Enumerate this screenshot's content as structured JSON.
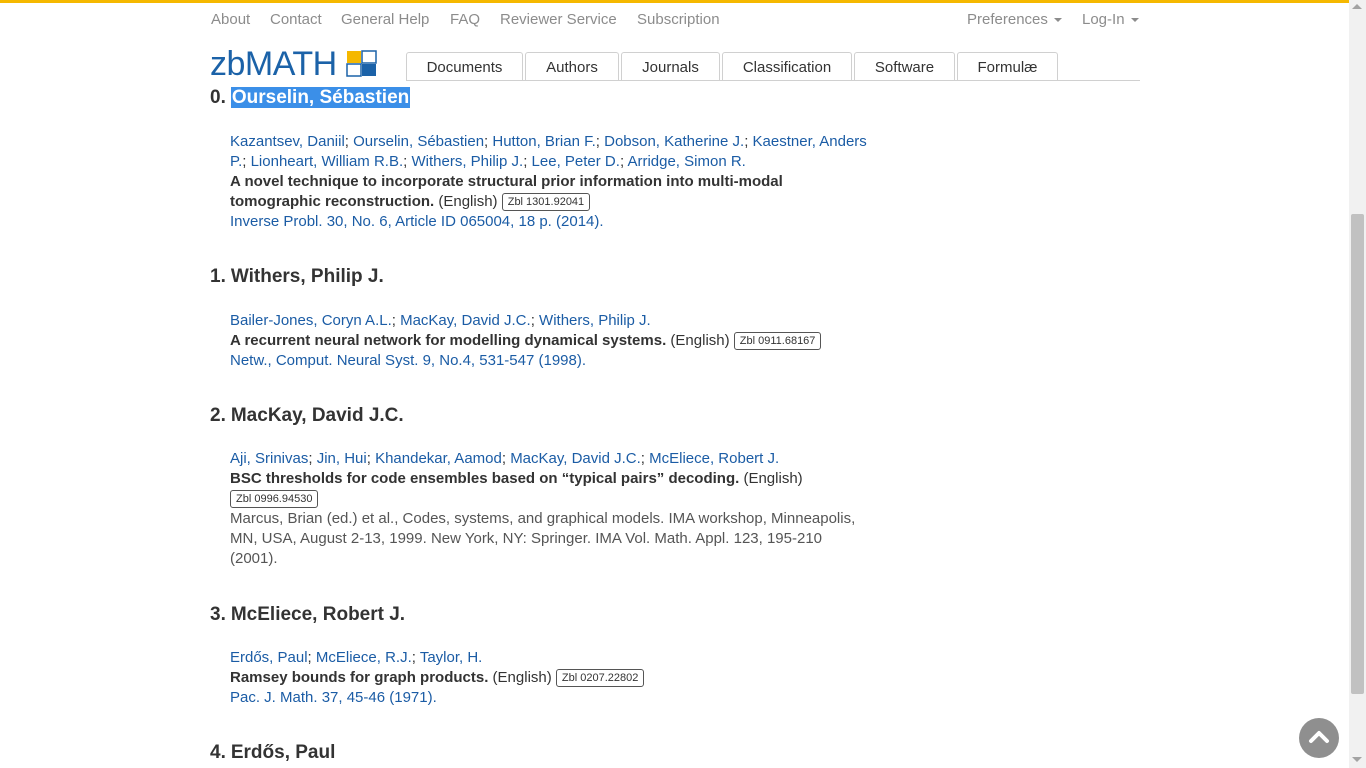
{
  "nav": {
    "about": "About",
    "contact": "Contact",
    "general_help": "General Help",
    "faq": "FAQ",
    "reviewer_service": "Reviewer Service",
    "subscription": "Subscription",
    "preferences": "Preferences",
    "login": "Log-In"
  },
  "logo": {
    "text": "zbMATH"
  },
  "tabs": [
    "Documents",
    "Authors",
    "Journals",
    "Classification",
    "Software",
    "Formulæ"
  ],
  "colors": {
    "link": "#1b5ca5",
    "accent": "#f5b800",
    "logo_blue": "#1b62a8",
    "highlight": "#3b8fe8"
  },
  "sections": [
    {
      "num": "0.",
      "name": "Ourselin, Sébastien",
      "authors": [
        "Kazantsev, Daniil",
        "Ourselin, Sébastien",
        "Hutton, Brian F.",
        "Dobson, Katherine J.",
        "Kaestner, Anders P.",
        "Lionheart, William R.B.",
        "Withers, Philip J.",
        "Lee, Peter D.",
        "Arridge, Simon R."
      ],
      "title": "A novel technique to incorporate structural prior information into multi-modal tomographic reconstruction.",
      "lang": "(English)",
      "zbl": "Zbl 1301.92041",
      "source": "Inverse Probl. 30, No. 6, Article ID 065004, 18 p. (2014)."
    },
    {
      "num": "1.",
      "name": "Withers, Philip J.",
      "authors": [
        "Bailer-Jones, Coryn A.L.",
        "MacKay, David J.C.",
        "Withers, Philip J."
      ],
      "title": "A recurrent neural network for modelling dynamical systems.",
      "lang": "(English)",
      "zbl": "Zbl 0911.68167",
      "source": "Netw., Comput. Neural Syst. 9, No.4, 531-547 (1998)."
    },
    {
      "num": "2.",
      "name": "MacKay, David J.C.",
      "authors": [
        "Aji, Srinivas",
        "Jin, Hui",
        "Khandekar, Aamod",
        "MacKay, David J.C.",
        "McEliece, Robert J."
      ],
      "title": "BSC thresholds for code ensembles based on “typical pairs” decoding.",
      "lang": "(English)",
      "zbl": "Zbl 0996.94530",
      "source": "Marcus, Brian (ed.) et al., Codes, systems, and graphical models. IMA workshop, Minneapolis, MN, USA, August 2-13, 1999. New York, NY: Springer. IMA Vol. Math. Appl. 123, 195-210 (2001)."
    },
    {
      "num": "3.",
      "name": "McEliece, Robert J.",
      "authors": [
        "Erdős, Paul",
        "McEliece, R.J.",
        "Taylor, H."
      ],
      "title": "Ramsey bounds for graph products.",
      "lang": "(English)",
      "zbl": "Zbl 0207.22802",
      "source": "Pac. J. Math. 37, 45-46 (1971)."
    },
    {
      "num": "4.",
      "name": "Erdős, Paul"
    }
  ]
}
